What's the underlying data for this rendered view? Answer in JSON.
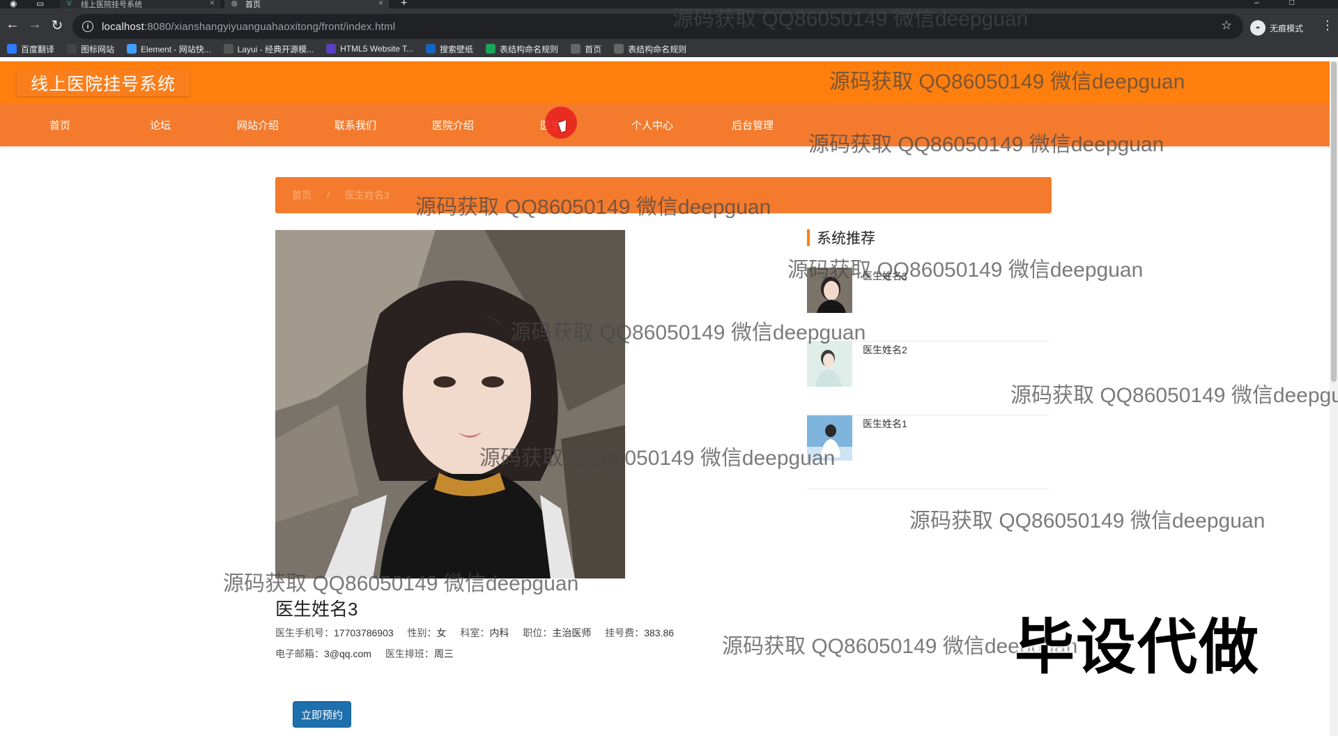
{
  "browser": {
    "tabs": [
      {
        "title": "线上医院挂号系统"
      },
      {
        "title": "首页"
      }
    ],
    "url_host": "localhost",
    "url_path": ":8080/xianshangyiyuanguahaoxitong/front/index.html",
    "incognito_label": "无痕模式",
    "bookmarks": [
      {
        "label": "百度翻译",
        "icon": "translate-icon",
        "color": "#2b7cff"
      },
      {
        "label": "图标网站",
        "icon": "flag-icon",
        "color": "#444444"
      },
      {
        "label": "Element - 网站快...",
        "icon": "element-icon",
        "color": "#409eff"
      },
      {
        "label": "Layui - 经典开源模...",
        "icon": "layui-icon",
        "color": "#555555"
      },
      {
        "label": "HTML5 Website T...",
        "icon": "html5-icon",
        "color": "#5a3fc0"
      },
      {
        "label": "搜索壁纸",
        "icon": "wallpaper-icon",
        "color": "#1565c0"
      },
      {
        "label": "表结构命名规则",
        "icon": "table-icon",
        "color": "#19a55b"
      },
      {
        "label": "首页",
        "icon": "globe-icon",
        "color": "#666666"
      },
      {
        "label": "表结构命名规则",
        "icon": "globe-icon",
        "color": "#666666"
      }
    ]
  },
  "site": {
    "logo": "线上医院挂号系统",
    "nav": [
      "首页",
      "论坛",
      "网站介绍",
      "联系我们",
      "医院介绍",
      "医生",
      "个人中心",
      "后台管理"
    ],
    "breadcrumb": [
      "首页",
      "/",
      "医生姓名3"
    ],
    "colors": {
      "header": "#ff7f0e",
      "nav": "#f47b2d",
      "button": "#1e6fae"
    }
  },
  "doctor": {
    "name": "医生姓名3",
    "phone_label": "医生手机号：",
    "phone": "17703786903",
    "gender_label": "性别：",
    "gender": "女",
    "dept_label": "科室：",
    "dept": "内科",
    "title_label": "职位：",
    "title": "主治医师",
    "fee_label": "挂号费：",
    "fee": "383.86",
    "email_label": "电子邮箱：",
    "email": "3@qq.com",
    "schedule_label": "医生排班：",
    "schedule": "周三",
    "reserve_button": "立即预约"
  },
  "sidebar": {
    "title": "系统推荐",
    "items": [
      {
        "name": "医生姓名3"
      },
      {
        "name": "医生姓名2"
      },
      {
        "name": "医生姓名1"
      }
    ]
  },
  "watermark": "源码获取 QQ86050149 微信deepguan",
  "stamp": "毕设代做"
}
